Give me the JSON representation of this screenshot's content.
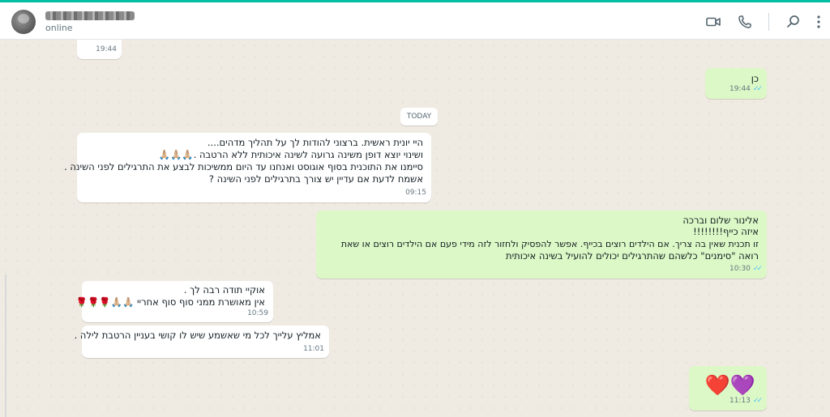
{
  "header": {
    "status": "online",
    "icons": [
      "video-call-icon",
      "voice-call-icon",
      "search-icon",
      "menu-icon"
    ]
  },
  "chat": {
    "date_divider": "TODAY",
    "messages": [
      {
        "dir": "in",
        "time": "19:44",
        "lines": []
      },
      {
        "dir": "out",
        "time": "19:44",
        "lines": [
          "כן"
        ]
      },
      {
        "dir": "in",
        "time": "09:15",
        "lines": [
          "היי יונית ראשית. ברצוני להודות לך על תהליך מדהים....",
          "ושינוי יוצא דופן משינה גרועה לשינה איכותית ללא הרטבה .🙏🏼🙏🏼🙏🏼",
          "סיימנו את התוכנית בסוף אוגוסט ואנחנו עד היום ממשיכות לבצע את התרגילים לפני השינה .",
          "אשמח לדעת אם עדיין יש צורך בתרגילים לפני השינה ?"
        ]
      },
      {
        "dir": "out",
        "time": "10:30",
        "lines": [
          "אלינור שלום וברכה",
          "איזה כייף!!!!!!!!",
          "זו תכנית שאין בה צריך. אם הילדים רוצים בכייף. אפשר להפסיק ולחזור לזה מידי פעם אם הילדים רוצים או שאת",
          "רואה \"סימנים\" כלשהם שהתרגילים יכולים להועיל בשינה איכותית"
        ]
      },
      {
        "dir": "in",
        "time": "10:59",
        "lines": [
          "אוקיי תודה רבה לך .",
          "אין מאושרת ממני סוף סוף אחריי 🙏🏼🙏🏼🌹🌹🌹"
        ]
      },
      {
        "dir": "in",
        "time": "11:01",
        "lines": [
          "אמליץ עלייך לכל מי שאשמע שיש לו קושי בעניין הרטבת לילה ."
        ]
      },
      {
        "dir": "out",
        "time": "11:13",
        "lines": [
          "❤️💜"
        ]
      }
    ]
  },
  "colors": {
    "accent": "#00bfa5",
    "chat_background": "#efeae2",
    "incoming_bubble": "#ffffff",
    "outgoing_bubble": "#dcf8c6",
    "read_ticks": "#4fc3f7"
  }
}
